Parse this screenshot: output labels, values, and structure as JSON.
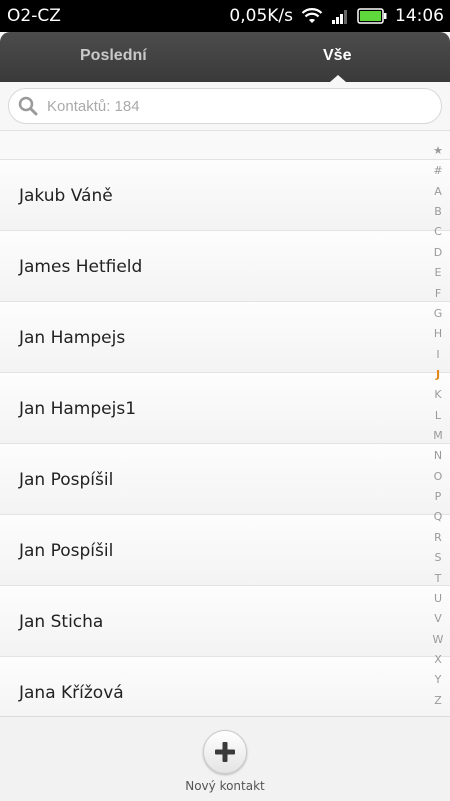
{
  "status_bar": {
    "carrier": "O2-CZ",
    "data_rate": "0,05K/s",
    "time": "14:06",
    "icons": [
      "wifi-icon",
      "signal-icon",
      "battery-icon"
    ]
  },
  "tabs": [
    {
      "label": "Poslední",
      "active": false
    },
    {
      "label": "Vše",
      "active": true
    }
  ],
  "search": {
    "placeholder": "Kontaktů: 184",
    "icon": "search-icon"
  },
  "contacts": [
    "Jakub Váně",
    "James Hetfield",
    "Jan Hampejs",
    "Jan Hampejs1",
    "Jan Pospíšil",
    "Jan Pospíšil",
    "Jan Sticha",
    "Jana Křížová"
  ],
  "alphabet_index": [
    "★",
    "#",
    "A",
    "B",
    "C",
    "D",
    "E",
    "F",
    "G",
    "H",
    "I",
    "J",
    "K",
    "L",
    "M",
    "N",
    "O",
    "P",
    "Q",
    "R",
    "S",
    "T",
    "U",
    "V",
    "W",
    "X",
    "Y",
    "Z"
  ],
  "alphabet_active": "J",
  "bottom": {
    "new_contact_label": "Nový kontakt",
    "icon": "plus-icon"
  },
  "colors": {
    "accent": "#e08a1e",
    "tabbar": "#424242"
  }
}
